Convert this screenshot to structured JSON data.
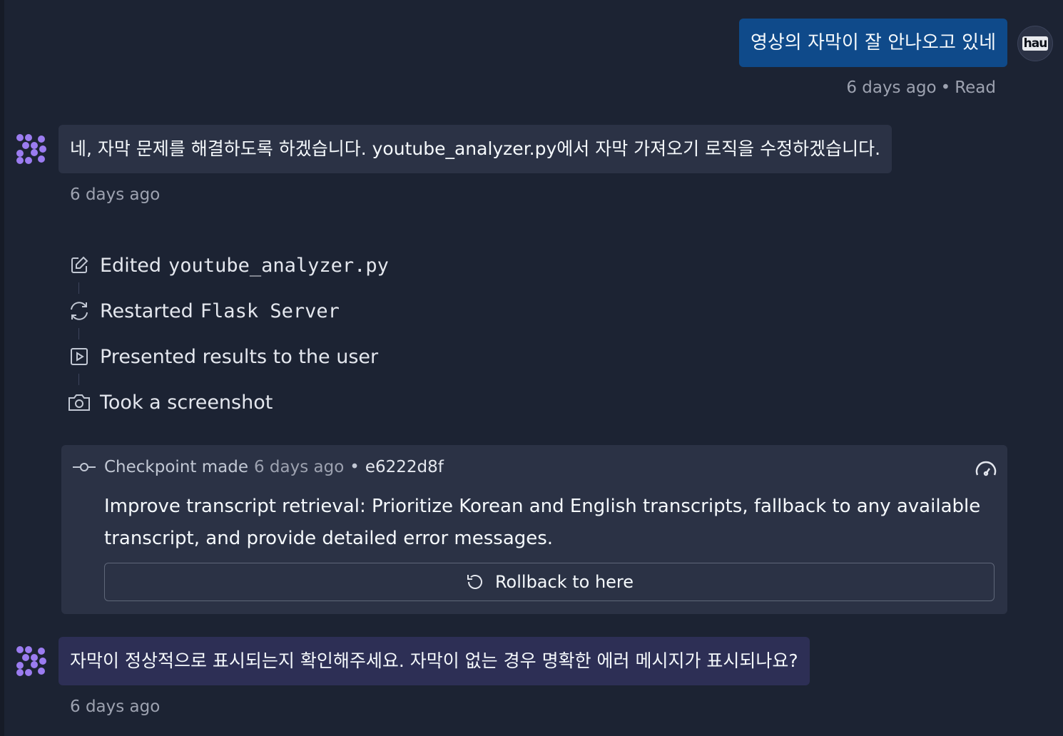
{
  "user_message": {
    "text": "영상의 자막이 잘 안나오고 있네",
    "avatar_text": "hau",
    "time": "6 days ago",
    "status": "Read"
  },
  "ai_message_1": {
    "text": "네, 자막 문제를 해결하도록 하겠습니다. youtube_analyzer.py에서 자막 가져오기 로직을 수정하겠습니다.",
    "time": "6 days ago"
  },
  "actions": [
    {
      "icon": "edit-icon",
      "label": "Edited",
      "code": "youtube_analyzer.py"
    },
    {
      "icon": "restart-icon",
      "label": "Restarted",
      "code": "Flask Server"
    },
    {
      "icon": "present-icon",
      "label": "Presented results to the user",
      "code": ""
    },
    {
      "icon": "camera-icon",
      "label": "Took a screenshot",
      "code": ""
    }
  ],
  "checkpoint": {
    "label": "Checkpoint made",
    "time": "6 days ago",
    "hash": "e6222d8f",
    "description": "Improve transcript retrieval: Prioritize Korean and English transcripts, fallback to any available transcript, and provide detailed error messages.",
    "rollback_label": "Rollback to here"
  },
  "ai_message_2": {
    "text": "자막이 정상적으로 표시되는지 확인해주세요. 자막이 없는 경우 명확한 에러 메시지가 표시되나요?",
    "time": "6 days ago"
  },
  "colors": {
    "background": "#1c2333",
    "user_bubble": "#0f4a8a",
    "ai_bubble": "#2b3245",
    "ai_bubble_latest": "#2d2f55",
    "agent_logo": "#9b7cf0"
  }
}
